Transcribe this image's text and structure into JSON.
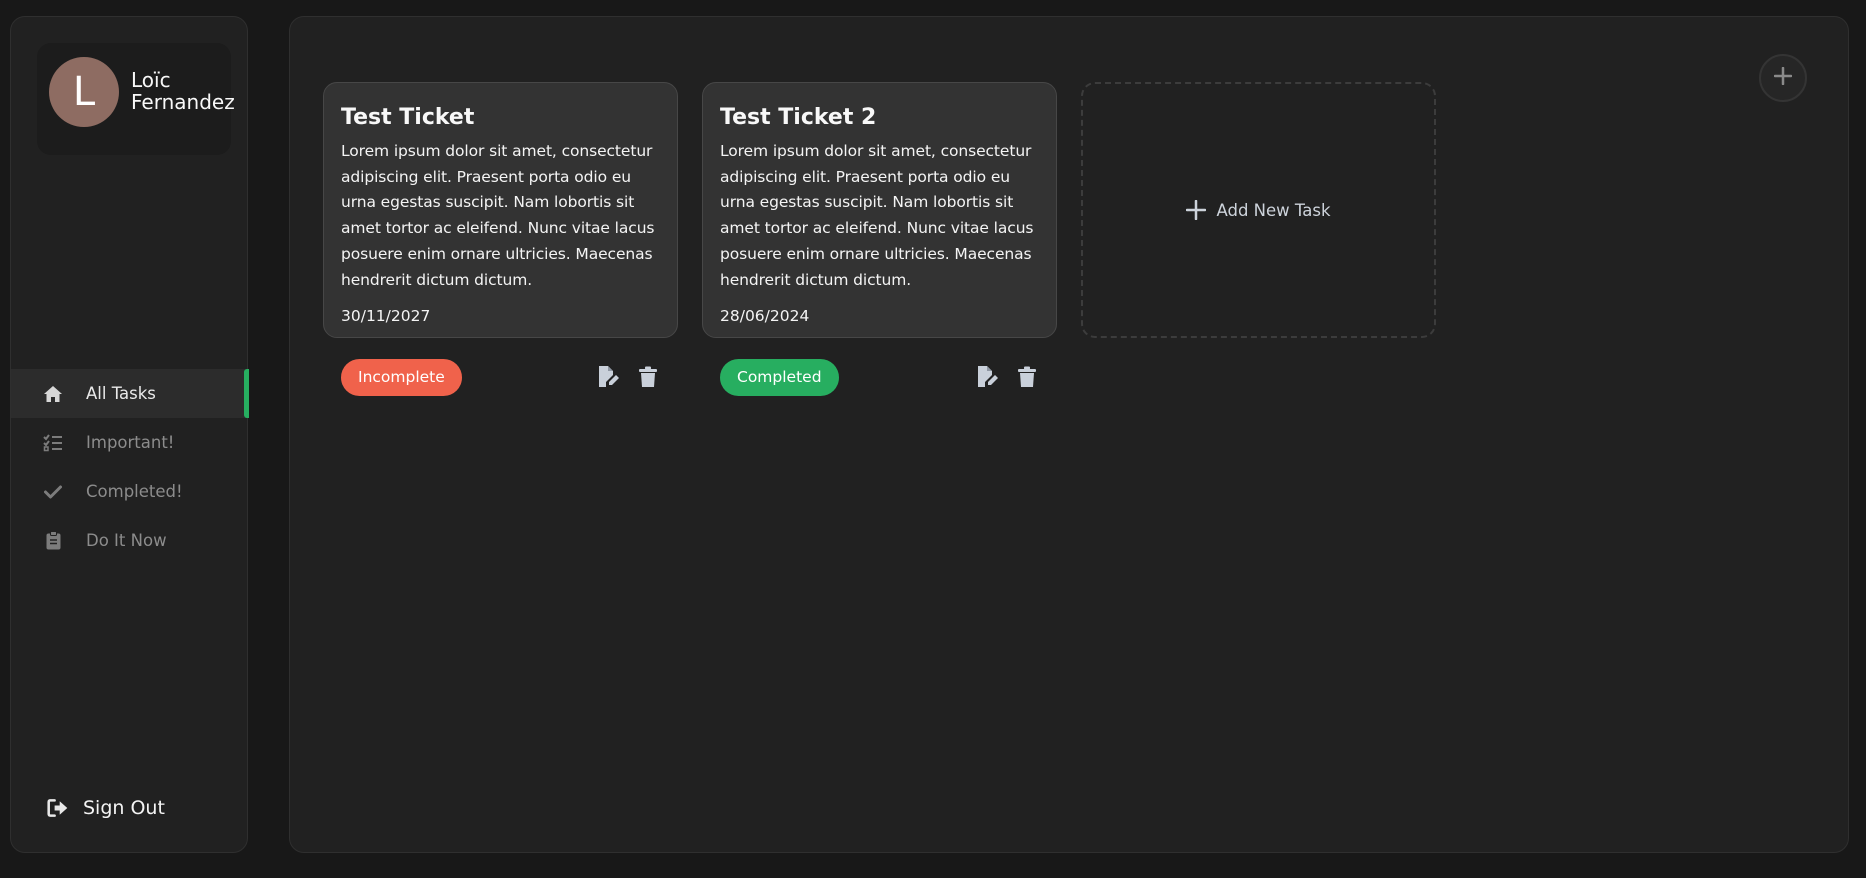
{
  "profile": {
    "initial": "L",
    "name": "Loïc Fernandez",
    "avatar_color": "#8e6c62"
  },
  "nav": [
    {
      "label": "All Tasks",
      "icon": "home-icon",
      "active": true
    },
    {
      "label": "Important!",
      "icon": "list-check-icon",
      "active": false
    },
    {
      "label": "Completed!",
      "icon": "check-icon",
      "active": false
    },
    {
      "label": "Do It Now",
      "icon": "clipboard-icon",
      "active": false
    }
  ],
  "signout": {
    "label": "Sign Out",
    "icon": "sign-out-icon"
  },
  "tasks": [
    {
      "title": "Test Ticket",
      "description": "Lorem ipsum dolor sit amet, consectetur adipiscing elit. Praesent porta odio eu urna egestas suscipit. Nam lobortis sit amet tortor ac eleifend. Nunc vitae lacus posuere enim ornare ultricies. Maecenas hendrerit dictum dictum.",
      "date": "30/11/2027",
      "status": "Incomplete",
      "status_color": "#f0624b"
    },
    {
      "title": "Test Ticket 2",
      "description": "Lorem ipsum dolor sit amet, consectetur adipiscing elit. Praesent porta odio eu urna egestas suscipit. Nam lobortis sit amet tortor ac eleifend. Nunc vitae lacus posuere enim ornare ultricies. Maecenas hendrerit dictum dictum.",
      "date": "28/06/2024",
      "status": "Completed",
      "status_color": "#27ae60"
    }
  ],
  "add_task": {
    "label": "Add New Task",
    "icon": "plus-icon"
  },
  "colors": {
    "accent": "#27ae60",
    "incomplete": "#f0624b",
    "background": "#181818",
    "panel": "#212121",
    "card": "#333333"
  }
}
